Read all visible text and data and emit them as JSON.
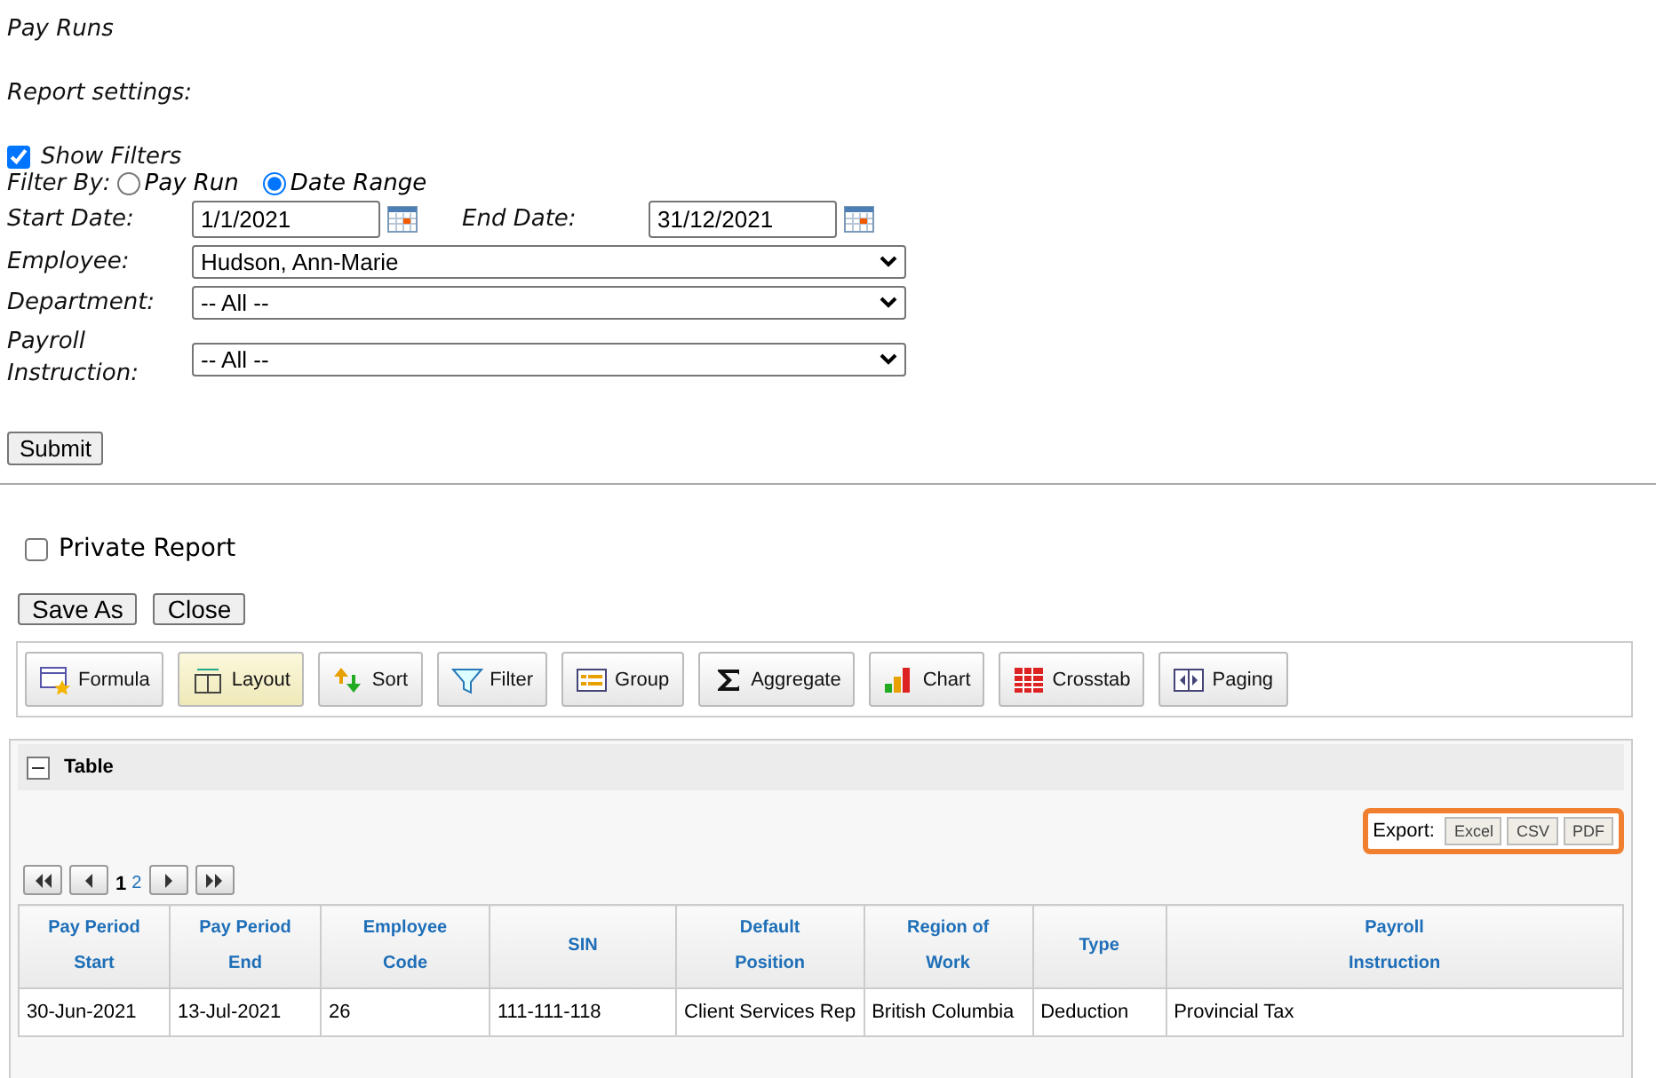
{
  "title": "Pay Runs",
  "settings_label": "Report settings:",
  "show_filters": {
    "label": "Show Filters",
    "checked": true
  },
  "filter_by": {
    "label": "Filter By:",
    "options": [
      {
        "label": "Pay Run",
        "selected": false
      },
      {
        "label": "Date Range",
        "selected": true
      }
    ]
  },
  "start_date": {
    "label": "Start Date:",
    "value": "1/1/2021"
  },
  "end_date": {
    "label": "End Date:",
    "value": "31/12/2021"
  },
  "selects": [
    {
      "label": "Employee:",
      "value": "Hudson, Ann-Marie"
    },
    {
      "label": "Department:",
      "value": "-- All --"
    },
    {
      "label": "Payroll Instruction:",
      "value": "-- All --"
    }
  ],
  "submit": "Submit",
  "private_report": {
    "label": "Private Report",
    "checked": false
  },
  "buttons": [
    "Save As",
    "Close"
  ],
  "toolbar": [
    {
      "kind": "formula",
      "label": "Formula",
      "selected": false
    },
    {
      "kind": "layout",
      "label": "Layout",
      "selected": true
    },
    {
      "kind": "sort",
      "label": "Sort",
      "selected": false
    },
    {
      "kind": "filter",
      "label": "Filter",
      "selected": false
    },
    {
      "kind": "group",
      "label": "Group",
      "selected": false
    },
    {
      "kind": "aggregate",
      "label": "Aggregate",
      "selected": false
    },
    {
      "kind": "chart",
      "label": "Chart",
      "selected": false
    },
    {
      "kind": "crosstab",
      "label": "Crosstab",
      "selected": false
    },
    {
      "kind": "paging",
      "label": "Paging",
      "selected": false
    }
  ],
  "table_panel": {
    "title": "Table",
    "expanded": true,
    "export": {
      "label": "Export:",
      "buttons": [
        "Excel",
        "CSV",
        "PDF"
      ]
    },
    "pages": [
      {
        "label": "1",
        "selected": true
      },
      {
        "label": "2",
        "selected": false
      }
    ],
    "columns": [
      "Pay Period Start",
      "Pay Period End",
      "Employee Code",
      "SIN",
      "Default Position",
      "Region of Work",
      "Type",
      "Payroll Instruction"
    ],
    "rows": [
      [
        "30-Jun-2021",
        "13-Jul-2021",
        "26",
        "111-111-118",
        "Client Services Rep",
        "British Columbia",
        "Deduction",
        "Provincial Tax"
      ]
    ]
  }
}
